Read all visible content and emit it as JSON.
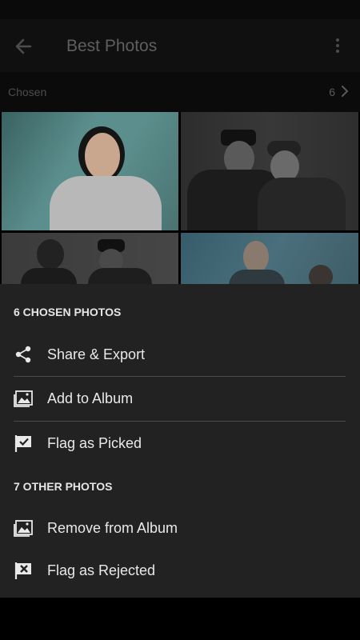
{
  "app_bar": {
    "title": "Best Photos",
    "back_icon": "arrow-left-icon",
    "menu_icon": "more-vertical-icon"
  },
  "section": {
    "label": "Chosen",
    "count": "6",
    "icon": "chevron-right-icon"
  },
  "sheet": {
    "groups": [
      {
        "title": "6 CHOSEN PHOTOS",
        "items": [
          {
            "label": "Share & Export",
            "icon": "share-icon"
          },
          {
            "label": "Add to Album",
            "icon": "album-icon"
          },
          {
            "label": "Flag as Picked",
            "icon": "flag-picked-icon"
          }
        ]
      },
      {
        "title": "7 OTHER PHOTOS",
        "items": [
          {
            "label": "Remove from Album",
            "icon": "album-icon"
          },
          {
            "label": "Flag as Rejected",
            "icon": "flag-rejected-icon"
          }
        ]
      }
    ]
  },
  "colors": {
    "sheet_bg": "#222222",
    "overlay": "#000000",
    "text": "#e9e9e9",
    "divider": "#4a4a4a"
  }
}
